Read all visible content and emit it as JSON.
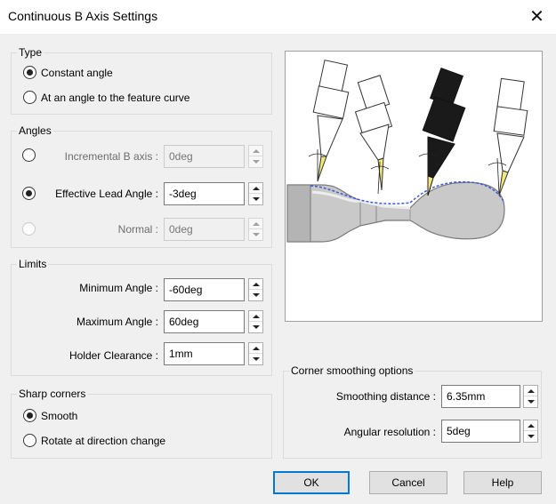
{
  "window": {
    "title": "Continuous B Axis Settings",
    "close_glyph": "✕"
  },
  "type_group": {
    "label": "Type",
    "options": [
      {
        "label": "Constant angle",
        "checked": true
      },
      {
        "label": "At an angle to the feature curve",
        "checked": false
      }
    ]
  },
  "angles_group": {
    "label": "Angles",
    "rows": [
      {
        "label": "Incremental B axis :",
        "value": "0deg",
        "checked": false,
        "enabled": false
      },
      {
        "label": "Effective Lead Angle :",
        "value": "-3deg",
        "checked": true,
        "enabled": true
      },
      {
        "label": "Normal :",
        "value": "0deg",
        "checked": false,
        "enabled": false
      }
    ]
  },
  "limits_group": {
    "label": "Limits",
    "rows": [
      {
        "label": "Minimum Angle :",
        "value": "-60deg"
      },
      {
        "label": "Maximum Angle :",
        "value": "60deg"
      },
      {
        "label": "Holder Clearance :",
        "value": "1mm"
      }
    ]
  },
  "sharp_corners_group": {
    "label": "Sharp corners",
    "options": [
      {
        "label": "Smooth",
        "checked": true
      },
      {
        "label": "Rotate at direction change",
        "checked": false
      }
    ]
  },
  "corner_smoothing_group": {
    "label": "Corner smoothing options",
    "rows": [
      {
        "label": "Smoothing distance :",
        "value": "6.35mm"
      },
      {
        "label": "Angular resolution :",
        "value": "5deg"
      }
    ]
  },
  "buttons": {
    "ok": "OK",
    "cancel": "Cancel",
    "help": "Help"
  },
  "colors": {
    "accent": "#0078d7",
    "active_tool": "#1a1a1a",
    "insert": "#f2e77a",
    "path": "#3b5bdb"
  }
}
